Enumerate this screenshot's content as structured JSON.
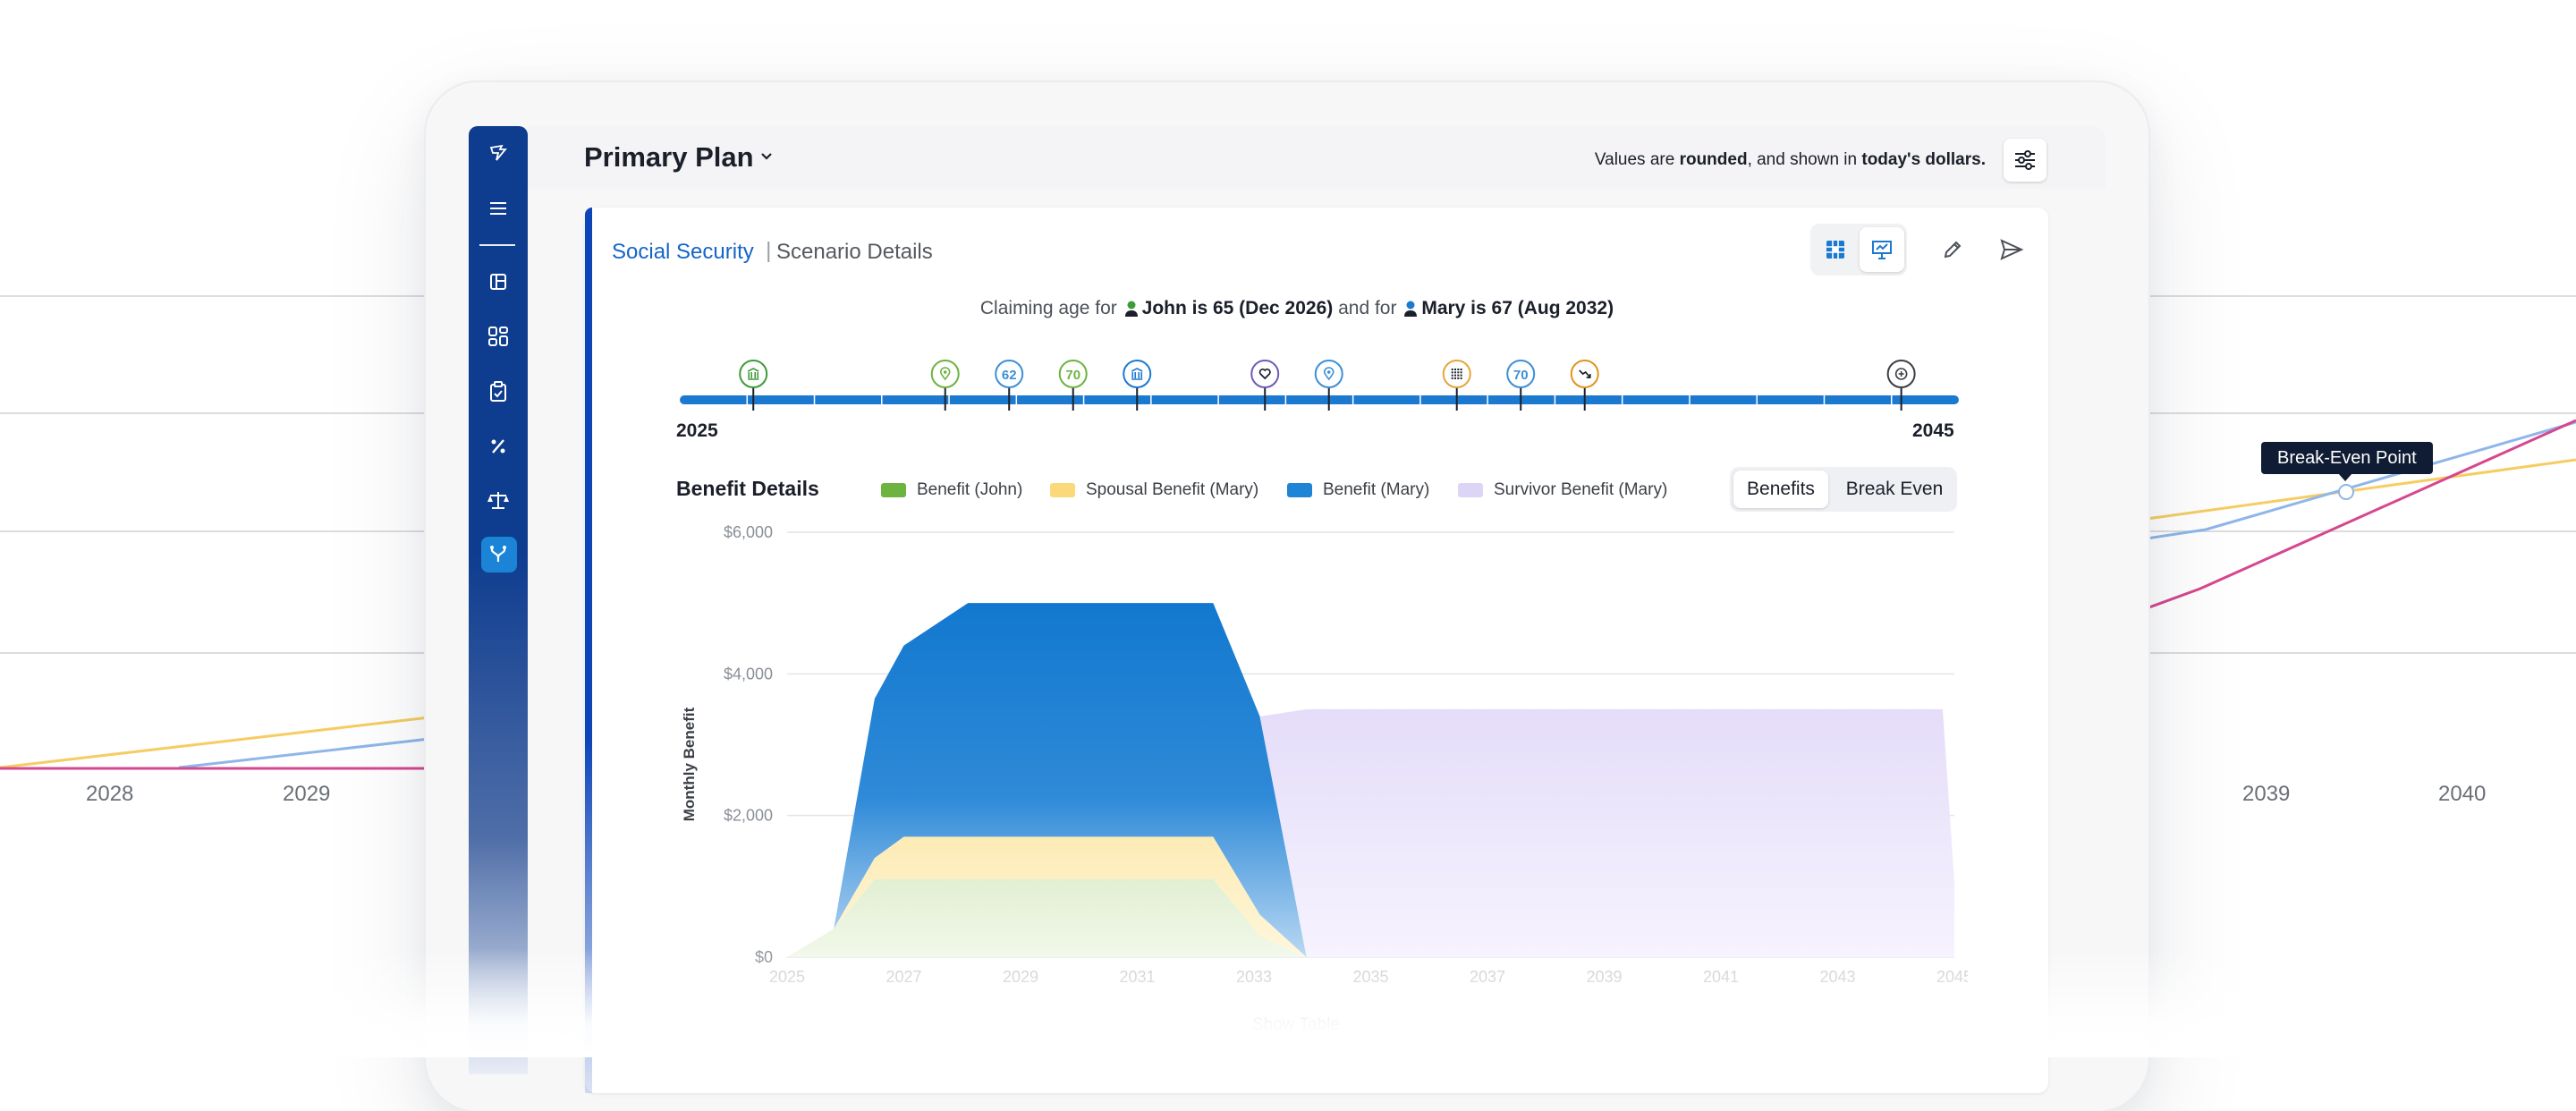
{
  "background_chart": {
    "left_years": [
      "2028",
      "2029"
    ],
    "right_years": [
      "2039",
      "2040"
    ],
    "tooltip": "Break-Even Point",
    "colors": {
      "spousal": "#f5cd62",
      "benefit": "#8fb6ea",
      "survivor": "#d6478f",
      "grid": "#dcdde0"
    }
  },
  "sidebar": {
    "items": [
      {
        "icon": "logo-icon"
      },
      {
        "icon": "menu-icon"
      },
      {
        "icon": "layout-icon"
      },
      {
        "icon": "dashboard-icon"
      },
      {
        "icon": "clipboard-icon"
      },
      {
        "icon": "percent-icon"
      },
      {
        "icon": "scale-icon"
      },
      {
        "icon": "branch-icon",
        "active": true
      }
    ]
  },
  "header": {
    "plan_title": "Primary Plan",
    "note_pre": "Values are ",
    "note_b1": "rounded",
    "note_mid": ", and shown in ",
    "note_b2": "today's dollars."
  },
  "card": {
    "breadcrumb_active": "Social Security",
    "breadcrumb_sep": "|",
    "breadcrumb_current": "Scenario Details",
    "claim_prefix": "Claiming age for",
    "claim_john": "John is 65 (Dec 2026)",
    "claim_and": "and for",
    "claim_mary": "Mary is 67 (Aug 2032)"
  },
  "timeline": {
    "start_year": "2025",
    "end_year": "2045",
    "markers": [
      {
        "kind": "icon",
        "icon": "building-icon",
        "color": "#3e9b3a"
      },
      {
        "kind": "icon",
        "icon": "pin-icon",
        "color": "#6db33f"
      },
      {
        "kind": "text",
        "label": "62",
        "color": "#3b8fd8"
      },
      {
        "kind": "text",
        "label": "70",
        "color": "#6db33f"
      },
      {
        "kind": "icon",
        "icon": "building-icon",
        "color": "#1c79d0"
      },
      {
        "kind": "icon",
        "icon": "heart-icon",
        "color": "#6e5bb8"
      },
      {
        "kind": "icon",
        "icon": "pin-icon",
        "color": "#3b8fd8"
      },
      {
        "kind": "icon",
        "icon": "grid-icon",
        "color": "#e5a63b"
      },
      {
        "kind": "text",
        "label": "70",
        "color": "#3b8fd8"
      },
      {
        "kind": "icon",
        "icon": "trend-down-icon",
        "color": "#e0941e"
      },
      {
        "kind": "icon",
        "icon": "add-icon",
        "color": "#3b3f46"
      }
    ]
  },
  "benefit_details": {
    "title": "Benefit Details",
    "legend": [
      {
        "label": "Benefit (John)",
        "color": "#6db33f"
      },
      {
        "label": "Spousal Benefit (Mary)",
        "color": "#fbd97a"
      },
      {
        "label": "Benefit (Mary)",
        "color": "#1e84d6"
      },
      {
        "label": "Survivor Benefit (Mary)",
        "color": "#ddd5f6"
      }
    ],
    "toggle": {
      "benefits": "Benefits",
      "break_even": "Break Even"
    },
    "show_table": "Show Table"
  },
  "chart_data": {
    "type": "area",
    "ylabel": "Monthly Benefit",
    "xlabel": "",
    "y_ticks": [
      "$0",
      "$2,000",
      "$4,000",
      "$6,000"
    ],
    "ylim": [
      0,
      6000
    ],
    "x_ticks": [
      "2025",
      "2027",
      "2029",
      "2031",
      "2033",
      "2035",
      "2037",
      "2039",
      "2041",
      "2043",
      "2045"
    ],
    "xlim": [
      2025,
      2045
    ],
    "stacked": true,
    "x": [
      2025,
      2025.8,
      2026.5,
      2027,
      2028.1,
      2032.3,
      2033.1,
      2033.9,
      2044.8,
      2045
    ],
    "series": [
      {
        "name": "Benefit (John)",
        "color": "#6db33f",
        "values": [
          0,
          400,
          1100,
          1100,
          1100,
          1100,
          300,
          0,
          0,
          0
        ]
      },
      {
        "name": "Spousal Benefit (Mary)",
        "color": "#fbd97a",
        "values": [
          0,
          0,
          300,
          600,
          600,
          600,
          300,
          0,
          0,
          0
        ]
      },
      {
        "name": "Benefit (Mary)",
        "color": "#1e84d6",
        "values": [
          0,
          0,
          2250,
          2700,
          3300,
          3300,
          2800,
          0,
          0,
          0
        ]
      },
      {
        "name": "Survivor Benefit (Mary)",
        "color": "#ddd5f6",
        "values": [
          0,
          0,
          0,
          0,
          0,
          0,
          0,
          3500,
          3500,
          1050
        ]
      }
    ]
  }
}
